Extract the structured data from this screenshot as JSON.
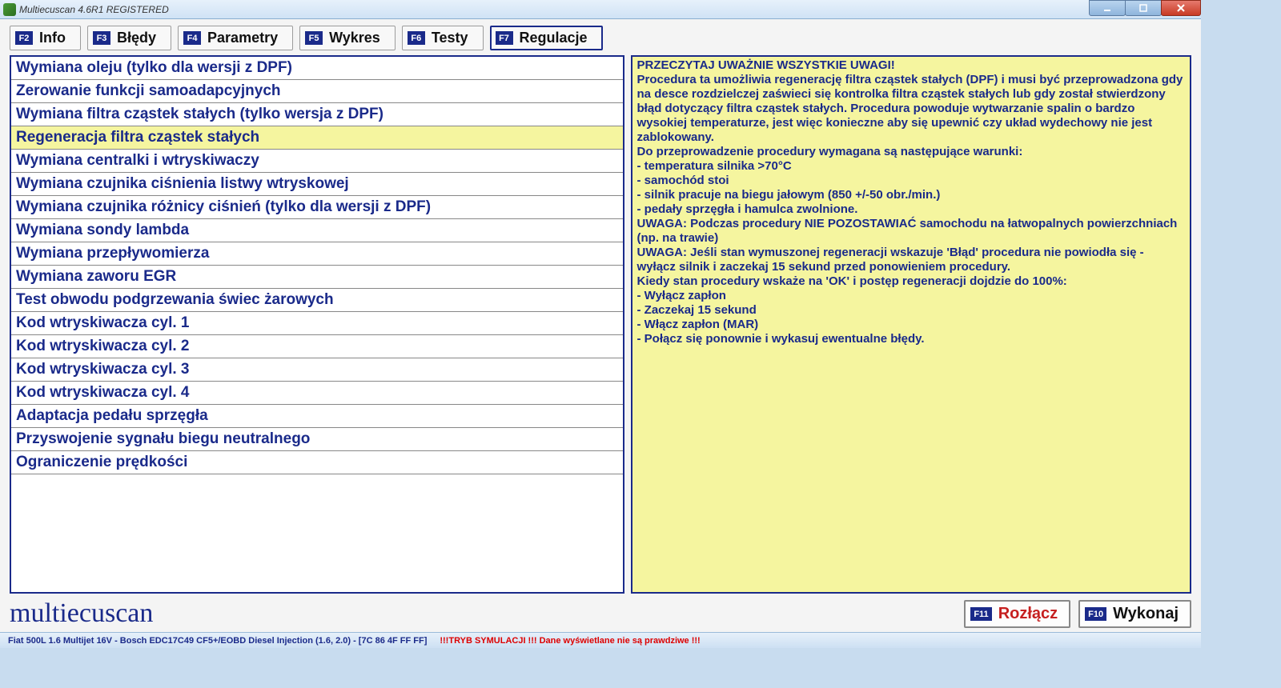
{
  "window": {
    "title": "Multiecuscan 4.6R1 REGISTERED"
  },
  "tabs": [
    {
      "key": "F2",
      "label": "Info"
    },
    {
      "key": "F3",
      "label": "Błędy"
    },
    {
      "key": "F4",
      "label": "Parametry"
    },
    {
      "key": "F5",
      "label": "Wykres"
    },
    {
      "key": "F6",
      "label": "Testy"
    },
    {
      "key": "F7",
      "label": "Regulacje"
    }
  ],
  "active_tab_index": 5,
  "list": [
    "Wymiana oleju (tylko dla wersji z DPF)",
    "Zerowanie funkcji samoadapcyjnych",
    "Wymiana filtra cząstek stałych (tylko wersja z DPF)",
    "Regeneracja filtra cząstek stałych",
    "Wymiana centralki i wtryskiwaczy",
    "Wymiana czujnika ciśnienia listwy wtryskowej",
    "Wymiana czujnika różnicy ciśnień (tylko dla wersji z DPF)",
    "Wymiana sondy lambda",
    "Wymiana przepływomierza",
    "Wymiana zaworu EGR",
    "Test obwodu podgrzewania świec żarowych",
    "Kod wtryskiwacza cyl. 1",
    "Kod wtryskiwacza cyl. 2",
    "Kod wtryskiwacza cyl. 3",
    "Kod wtryskiwacza cyl. 4",
    "Adaptacja pedału sprzęgła",
    "Przyswojenie sygnału biegu neutralnego",
    "Ograniczenie prędkości"
  ],
  "selected_list_index": 3,
  "description": "PRZECZYTAJ UWAŻNIE WSZYSTKIE UWAGI!\nProcedura ta umożliwia regenerację filtra cząstek stałych (DPF) i musi być przeprowadzona gdy na desce rozdzielczej zaświeci się kontrolka filtra cząstek stałych lub gdy został stwierdzony błąd dotyczący filtra cząstek stałych. Procedura powoduje wytwarzanie spalin o bardzo wysokiej temperaturze, jest więc konieczne aby się upewnić czy układ wydechowy nie jest zablokowany.\nDo przeprowadzenie procedury wymagana są następujące warunki:\n- temperatura silnika >70°C\n- samochód stoi\n- silnik pracuje na biegu jałowym (850 +/-50 obr./min.)\n- pedały sprzęgła i hamulca zwolnione.\nUWAGA: Podczas procedury NIE POZOSTAWIAĆ samochodu na łatwopalnych powierzchniach (np. na trawie)\nUWAGA: Jeśli stan wymuszonej regeneracji wskazuje 'Błąd' procedura nie powiodła się - wyłącz silnik i zaczekaj 15 sekund przed ponowieniem procedury.\nKiedy stan procedury wskaże na 'OK' i postęp regeneracji dojdzie do 100%:\n- Wyłącz zapłon\n- Zaczekaj 15 sekund\n- Włącz zapłon (MAR)\n- Połącz się ponownie i wykasuj ewentualne błędy.",
  "brand": "multiecuscan",
  "actions": {
    "disconnect": {
      "key": "F11",
      "label": "Rozłącz"
    },
    "execute": {
      "key": "F10",
      "label": "Wykonaj"
    }
  },
  "status": {
    "vehicle": "Fiat 500L 1.6 Multijet 16V - Bosch EDC17C49 CF5+/EOBD Diesel Injection (1.6, 2.0) - [7C 86 4F FF FF]",
    "simulation": "!!!TRYB SYMULACJI !!! Dane wyświetlane nie są prawdziwe !!!"
  }
}
